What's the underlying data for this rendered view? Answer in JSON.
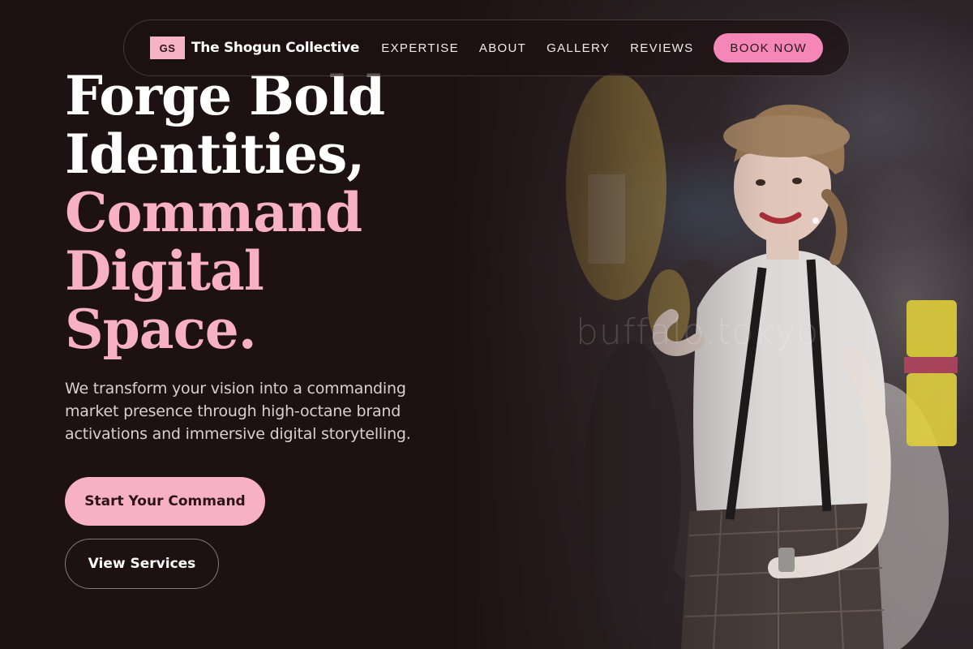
{
  "brand": {
    "badge": "GS",
    "name": "The Shogun Collective"
  },
  "nav": {
    "links": [
      "EXPERTISE",
      "ABOUT",
      "GALLERY",
      "REVIEWS"
    ],
    "cta": "BOOK NOW"
  },
  "hero": {
    "title_lines_white": [
      "Forge Bold",
      "Identities,"
    ],
    "title_lines_pink": [
      "Command",
      "Digital",
      "Space."
    ],
    "description": "We transform your vision into a commanding market presence through high-octane brand activations and immersive digital storytelling.",
    "primary_cta": "Start Your Command",
    "secondary_cta": "View Services",
    "photo_watermark": "buffalo.tokyo"
  },
  "colors": {
    "background": "#1d1113",
    "accent_pink": "#f7b0c6",
    "button_pink": "#f487b7"
  }
}
